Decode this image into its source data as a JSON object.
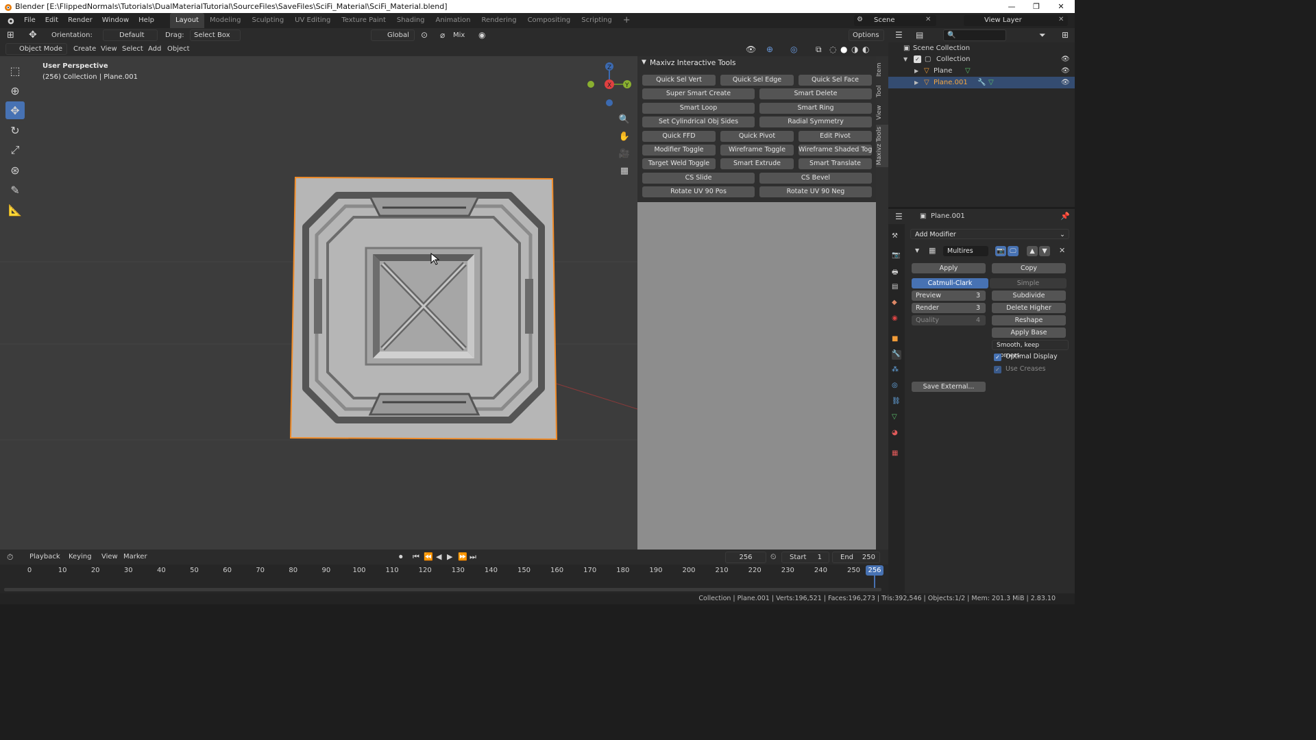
{
  "window": {
    "title": "Blender [E:\\FlippedNormals\\Tutorials\\DualMaterialTutorial\\SourceFiles\\SaveFiles\\SciFi_Material\\SciFi_Material.blend]",
    "minimize": "—",
    "restore": "❐",
    "close": "✕"
  },
  "menu": {
    "items": [
      "File",
      "Edit",
      "Render",
      "Window",
      "Help"
    ],
    "workspaces": [
      "Layout",
      "Modeling",
      "Sculpting",
      "UV Editing",
      "Texture Paint",
      "Shading",
      "Animation",
      "Rendering",
      "Compositing",
      "Scripting"
    ],
    "add_workspace": "+",
    "scene_label": "Scene",
    "view_layer_label": "View Layer"
  },
  "tool_header": {
    "orientation_label": "Orientation:",
    "orientation_value": "Default",
    "drag_label": "Drag:",
    "drag_value": "Select Box",
    "transform_orientation": "Global",
    "snap_mode": "Mix",
    "options": "Options"
  },
  "viewport_header": {
    "mode": "Object Mode",
    "menus": [
      "Create",
      "View",
      "Select",
      "Add",
      "Object"
    ]
  },
  "viewport": {
    "perspective": "User Perspective",
    "collection_info": "(256) Collection | Plane.001",
    "gizmo": {
      "x": "X",
      "y": "Y",
      "z": "Z"
    }
  },
  "maxivz": {
    "title": "Maxivz Interactive Tools",
    "rows": [
      [
        "Quick Sel Vert",
        "Quick Sel Edge",
        "Quick Sel Face"
      ],
      [
        "Super Smart Create",
        "Smart Delete"
      ],
      [
        "Smart Loop",
        "Smart Ring"
      ],
      [
        "Set Cylindrical Obj Sides",
        "Radial Symmetry"
      ],
      [
        "Quick FFD",
        "Quick Pivot",
        "Edit Pivot"
      ],
      [
        "Modifier Toggle",
        "Wireframe Toggle",
        "Wireframe Shaded Toggle"
      ],
      [
        "Target Weld Toggle",
        "Smart Extrude",
        "Smart Translate"
      ],
      [
        "CS Slide",
        "CS Bevel"
      ],
      [
        "Rotate UV 90 Pos",
        "Rotate UV 90 Neg"
      ]
    ],
    "side_tabs": [
      "Item",
      "Tool",
      "View",
      "Maxivz Tools"
    ]
  },
  "outliner": {
    "root": "Scene Collection",
    "collection": "Collection",
    "objects": [
      "Plane",
      "Plane.001"
    ]
  },
  "properties": {
    "object_name": "Plane.001",
    "add_modifier": "Add Modifier",
    "modifier_name": "Multires",
    "apply": "Apply",
    "copy": "Copy",
    "catmull_clark": "Catmull-Clark",
    "simple": "Simple",
    "preview_label": "Preview",
    "preview_value": "3",
    "render_label": "Render",
    "render_value": "3",
    "quality_label": "Quality",
    "quality_value": "4",
    "subdivide": "Subdivide",
    "delete_higher": "Delete Higher",
    "reshape": "Reshape",
    "apply_base": "Apply Base",
    "uv_smooth": "Smooth, keep corners",
    "optimal_display": "Optimal Display",
    "use_creases": "Use Creases",
    "save_external": "Save External..."
  },
  "timeline": {
    "menus": [
      "Playback",
      "Keying",
      "View",
      "Marker"
    ],
    "current_frame": "256",
    "start_label": "Start",
    "start_value": "1",
    "end_label": "End",
    "end_value": "250",
    "ticks": [
      "0",
      "10",
      "20",
      "30",
      "40",
      "50",
      "60",
      "70",
      "80",
      "90",
      "100",
      "110",
      "120",
      "130",
      "140",
      "150",
      "160",
      "170",
      "180",
      "190",
      "200",
      "210",
      "220",
      "230",
      "240",
      "250"
    ],
    "playhead": "256"
  },
  "status": {
    "text": "Collection | Plane.001 | Verts:196,521 | Faces:196,273 | Tris:392,546 | Objects:1/2 | Mem: 201.3 MiB | 2.83.10"
  },
  "colors": {
    "accent": "#4772b3",
    "selection_outline": "#f28c28",
    "viewport_bg": "#3c3c3c"
  }
}
